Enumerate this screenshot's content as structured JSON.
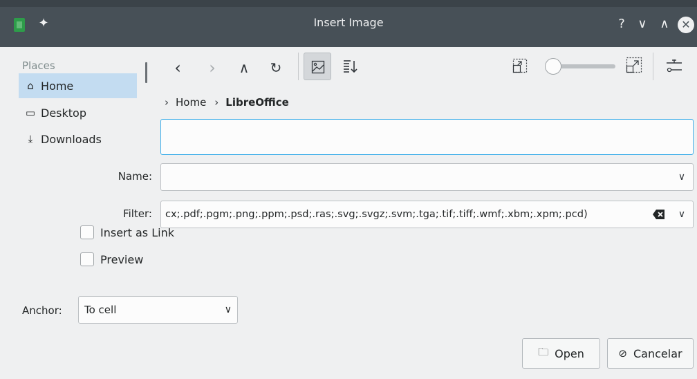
{
  "window": {
    "title": "Insert Image",
    "help": "?",
    "minimize": "∨",
    "maximize": "∧",
    "close": "✕"
  },
  "places": {
    "title": "Places",
    "items": [
      {
        "label": "Home",
        "icon": "home-icon"
      },
      {
        "label": "Desktop",
        "icon": "desktop-icon"
      },
      {
        "label": "Downloads",
        "icon": "downloads-icon"
      }
    ]
  },
  "toolbar": {
    "back": "‹",
    "forward": "›",
    "up": "∧",
    "reload": "↻",
    "zoom_level": 0.1
  },
  "breadcrumb": {
    "chevron": "›",
    "items": [
      "Home",
      "LibreOffice"
    ]
  },
  "fields": {
    "name_label": "Name:",
    "name_value": "",
    "filter_label": "Filter:",
    "filter_value": "cx;.pdf;.pgm;.png;.ppm;.psd;.ras;.svg;.svgz;.svm;.tga;.tif;.tiff;.wmf;.xbm;.xpm;.pcd)",
    "arrow": "∨"
  },
  "options": {
    "insert_as_link": "Insert as Link",
    "preview": "Preview",
    "anchor_label": "Anchor:",
    "anchor_value": "To cell"
  },
  "buttons": {
    "open": "Open",
    "cancel": "Cancelar"
  },
  "colors": {
    "titlebar": "#475057",
    "accent": "#3daee9",
    "selection": "#c3dcf1"
  }
}
